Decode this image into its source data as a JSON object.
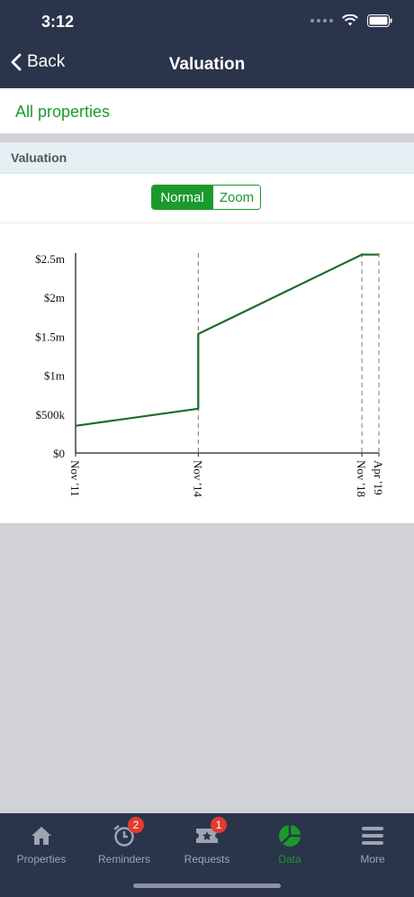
{
  "status": {
    "time": "3:12"
  },
  "nav": {
    "back_label": "Back",
    "title": "Valuation"
  },
  "all_properties": {
    "label": "All properties"
  },
  "section": {
    "title": "Valuation"
  },
  "toggle": {
    "options": [
      "Normal",
      "Zoom"
    ],
    "selected": "Normal"
  },
  "chart_data": {
    "type": "line",
    "title": "",
    "xlabel": "",
    "ylabel": "",
    "ylim": [
      0,
      2500000
    ],
    "y_ticks": [
      "$0",
      "$500k",
      "$1m",
      "$1.5m",
      "$2m",
      "$2.5m"
    ],
    "x_ticks": [
      "Nov '11",
      "Nov '14",
      "Nov '18",
      "Apr '19"
    ],
    "series": [
      {
        "color": "#1f6b2a",
        "points": [
          {
            "x": "Nov '11",
            "y": 350000
          },
          {
            "x": "Nov '14",
            "y": 570000
          },
          {
            "x": "Nov '14",
            "y": 1530000
          },
          {
            "x": "Nov '18",
            "y": 2550000
          },
          {
            "x": "Apr '19",
            "y": 2550000
          }
        ]
      }
    ],
    "vertical_markers": [
      "Nov '14",
      "Nov '18",
      "Apr '19"
    ],
    "grid": false
  },
  "tabs": [
    {
      "label": "Properties",
      "icon": "home-icon",
      "badge": ""
    },
    {
      "label": "Reminders",
      "icon": "alarm-clock-icon",
      "badge": "2"
    },
    {
      "label": "Requests",
      "icon": "ticket-icon",
      "badge": "1"
    },
    {
      "label": "Data",
      "icon": "pie-chart-icon",
      "badge": ""
    },
    {
      "label": "More",
      "icon": "menu-icon",
      "badge": ""
    }
  ],
  "colors": {
    "accent": "#1a9a2c",
    "header": "#2a344b",
    "section_bg": "#e4f0f4",
    "badge": "#e33b2f"
  }
}
